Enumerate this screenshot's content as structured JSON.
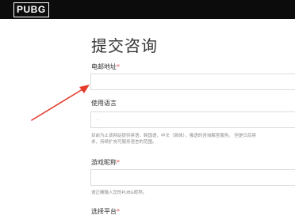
{
  "header": {
    "logo_text": "PUBG"
  },
  "form": {
    "title": "提交咨询",
    "email": {
      "label": "电邮地址",
      "required_mark": "*",
      "value": ""
    },
    "language": {
      "label": "使用语言",
      "selected_value": "-",
      "help_line1": "目前为止该网站提供英语，韩国语，中文（简体），俄语的咨询解答服务。 但是日后将",
      "help_line2": "求，持续扩充可服务语言的范围。"
    },
    "nickname": {
      "label": "游戏昵称",
      "required_mark": "*",
      "value": "",
      "help": "请正确输入您的PUBG昵称。"
    },
    "platform": {
      "label": "选择平台",
      "required_mark": "*"
    }
  },
  "colors": {
    "header_bg": "#0c0c0c",
    "required": "#e8504a",
    "annotation_arrow": "#e53b2c"
  }
}
